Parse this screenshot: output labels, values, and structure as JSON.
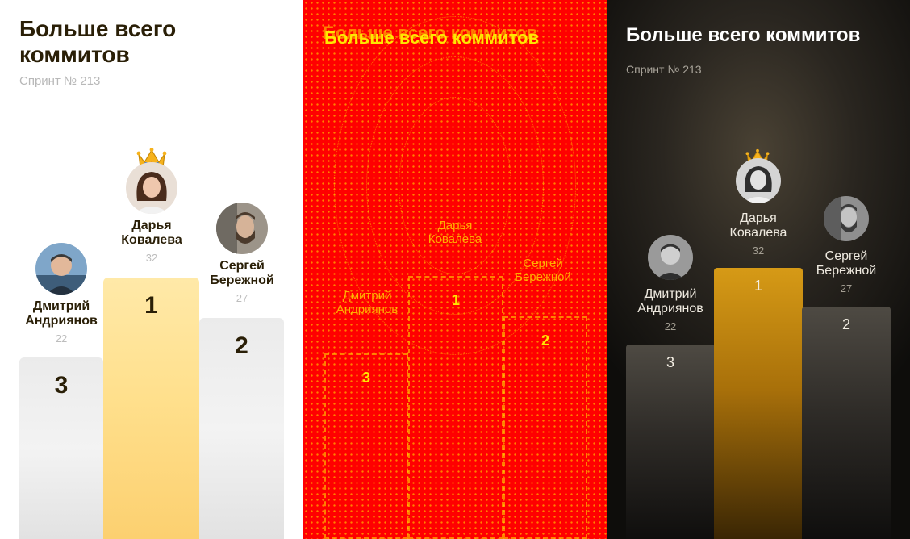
{
  "title": "Больше всего коммитов",
  "subtitle": "Спринт № 213",
  "podium": [
    {
      "place": "1",
      "name_line1": "Дарья",
      "name_line2": "Ковалева",
      "score": "32"
    },
    {
      "place": "2",
      "name_line1": "Сергей",
      "name_line2": "Бережной",
      "score": "27"
    },
    {
      "place": "3",
      "name_line1": "Дмитрий",
      "name_line2": "Андриянов",
      "score": "22"
    }
  ],
  "colors": {
    "gold_light": "#ffe08d",
    "gold_dark": "#b47a0c",
    "diff_bg": "#ff0000",
    "diff_fg": "#ffe700"
  },
  "icons": {
    "winner": "crown-icon",
    "avatar": "avatar-photo"
  }
}
